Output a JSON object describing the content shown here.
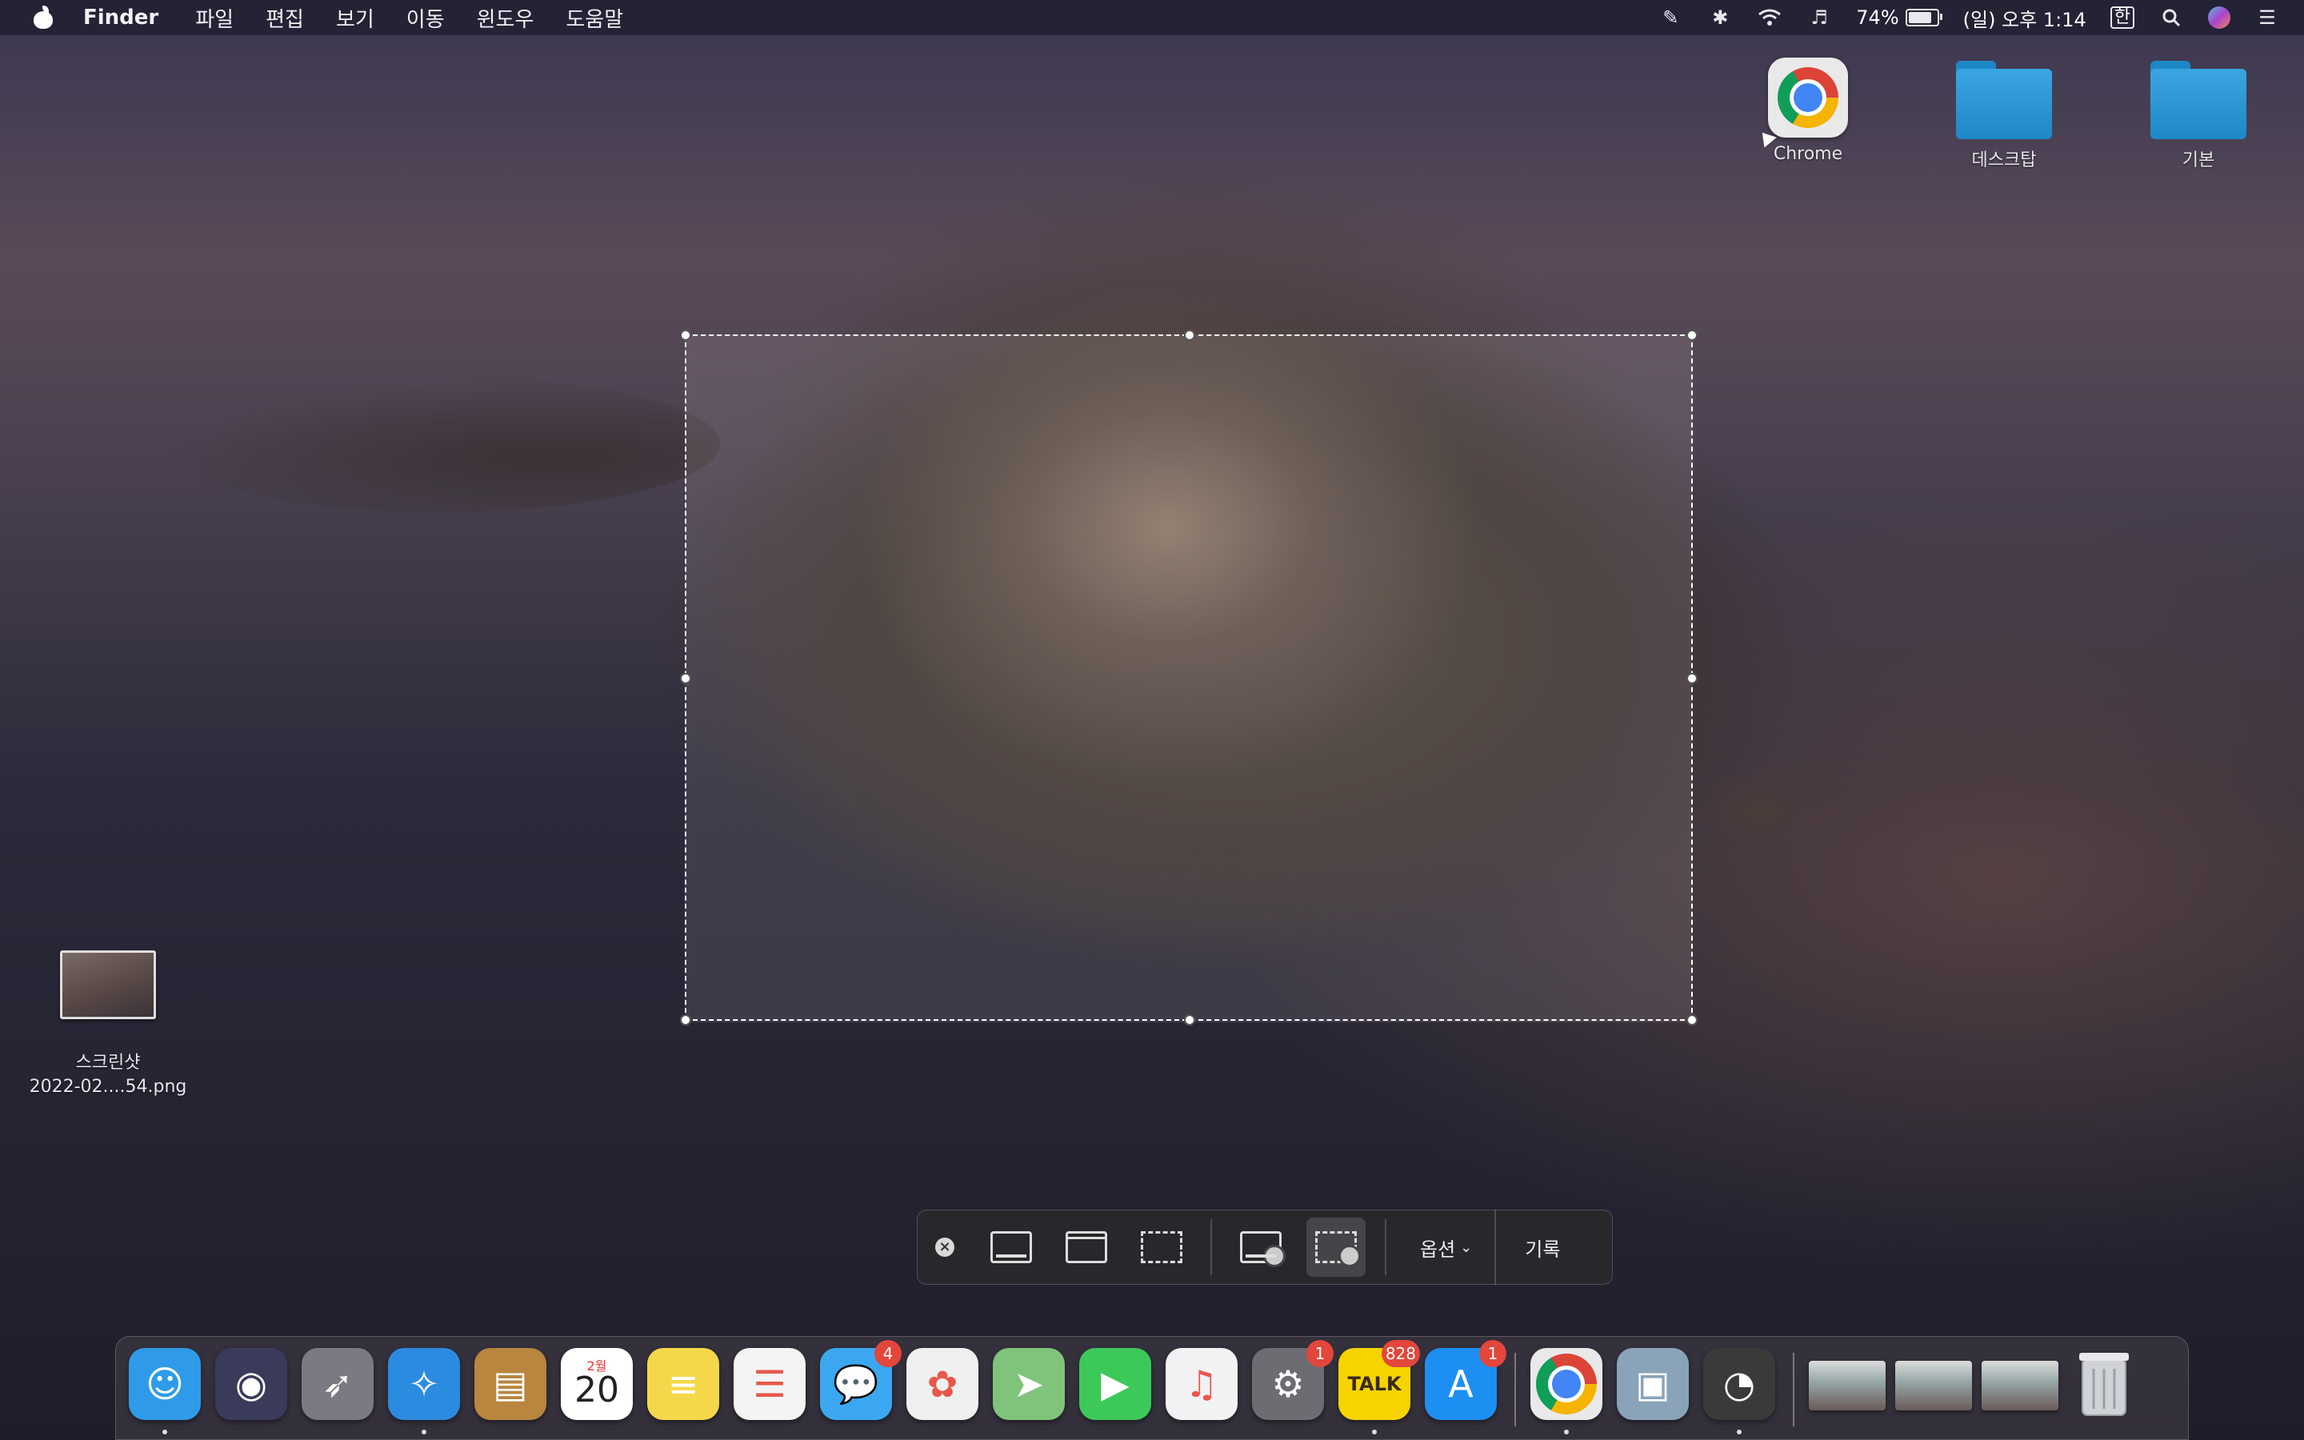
{
  "menubar": {
    "app_name": "Finder",
    "menus": [
      "파일",
      "편집",
      "보기",
      "이동",
      "윈도우",
      "도움말"
    ],
    "battery_percent": "74%",
    "battery_fraction": 0.74,
    "datetime": "(일) 오후 1:14",
    "input_source": "한",
    "icons": [
      "notification-icon",
      "bluetooth-icon",
      "wifi-icon",
      "volume-icon",
      "battery-icon",
      "search-icon",
      "siri-icon",
      "control-center-icon"
    ]
  },
  "desktop": {
    "icons": [
      {
        "label": "Chrome",
        "kind": "chrome"
      },
      {
        "label": "데스크탑",
        "kind": "folder"
      },
      {
        "label": "기본",
        "kind": "folder"
      }
    ],
    "file": {
      "line1": "스크린샷",
      "line2": "2022-02....54.png"
    }
  },
  "screenshot_toolbar": {
    "close_icon": "close-icon",
    "tools": [
      {
        "name": "capture-entire-screen",
        "icon": "screen-icon"
      },
      {
        "name": "capture-window",
        "icon": "window-icon"
      },
      {
        "name": "capture-selection",
        "icon": "selection-icon"
      },
      {
        "name": "record-entire-screen",
        "icon": "record-screen-icon"
      },
      {
        "name": "record-selection",
        "icon": "record-selection-icon",
        "active": true
      }
    ],
    "options_label": "옵션",
    "record_label": "기록"
  },
  "dock": {
    "apps": [
      {
        "name": "finder",
        "icon": "finder-icon",
        "color": "#2f9be8",
        "running": true
      },
      {
        "name": "siri",
        "icon": "siri-icon",
        "color": "#3a3a5a"
      },
      {
        "name": "launchpad",
        "icon": "rocket-icon",
        "color": "#7a7a82"
      },
      {
        "name": "safari",
        "icon": "compass-icon",
        "color": "#2b8be0",
        "running": true
      },
      {
        "name": "contacts",
        "icon": "contacts-icon",
        "color": "#b8863f"
      },
      {
        "name": "calendar",
        "icon": "calendar-icon",
        "color": "#ffffff",
        "month": "2월",
        "day": "20"
      },
      {
        "name": "notes",
        "icon": "notes-icon",
        "color": "#f5d84a"
      },
      {
        "name": "reminders",
        "icon": "reminders-icon",
        "color": "#f4f4f4"
      },
      {
        "name": "messages",
        "icon": "messages-icon",
        "color": "#3aa7f0",
        "badge": "4"
      },
      {
        "name": "photos",
        "icon": "photos-icon",
        "color": "#f0f0f0"
      },
      {
        "name": "maps",
        "icon": "maps-icon",
        "color": "#7fc47a"
      },
      {
        "name": "facetime",
        "icon": "facetime-icon",
        "color": "#3cc95a"
      },
      {
        "name": "music",
        "icon": "music-icon",
        "color": "#f2f2f5"
      },
      {
        "name": "system-preferences",
        "icon": "gear-icon",
        "color": "#6c6c72",
        "badge": "1"
      },
      {
        "name": "kakaotalk",
        "icon": "kakaotalk-icon",
        "color": "#f7d300",
        "badge": "828",
        "label": "TALK",
        "running": true
      },
      {
        "name": "app-store",
        "icon": "app-store-icon",
        "color": "#1d8ff2",
        "badge": "1"
      },
      {
        "name": "chrome",
        "icon": "chrome-icon",
        "color": "#e9e9e9",
        "running": true
      },
      {
        "name": "preview",
        "icon": "preview-icon",
        "color": "#8aa3b8"
      },
      {
        "name": "screen-recorder",
        "icon": "recorder-icon",
        "color": "#3a3a3a",
        "running": true
      }
    ],
    "minimized": [
      "minimized-safari-window",
      "minimized-finder-window",
      "minimized-chrome-window"
    ],
    "trash_icon": "trash-icon"
  }
}
